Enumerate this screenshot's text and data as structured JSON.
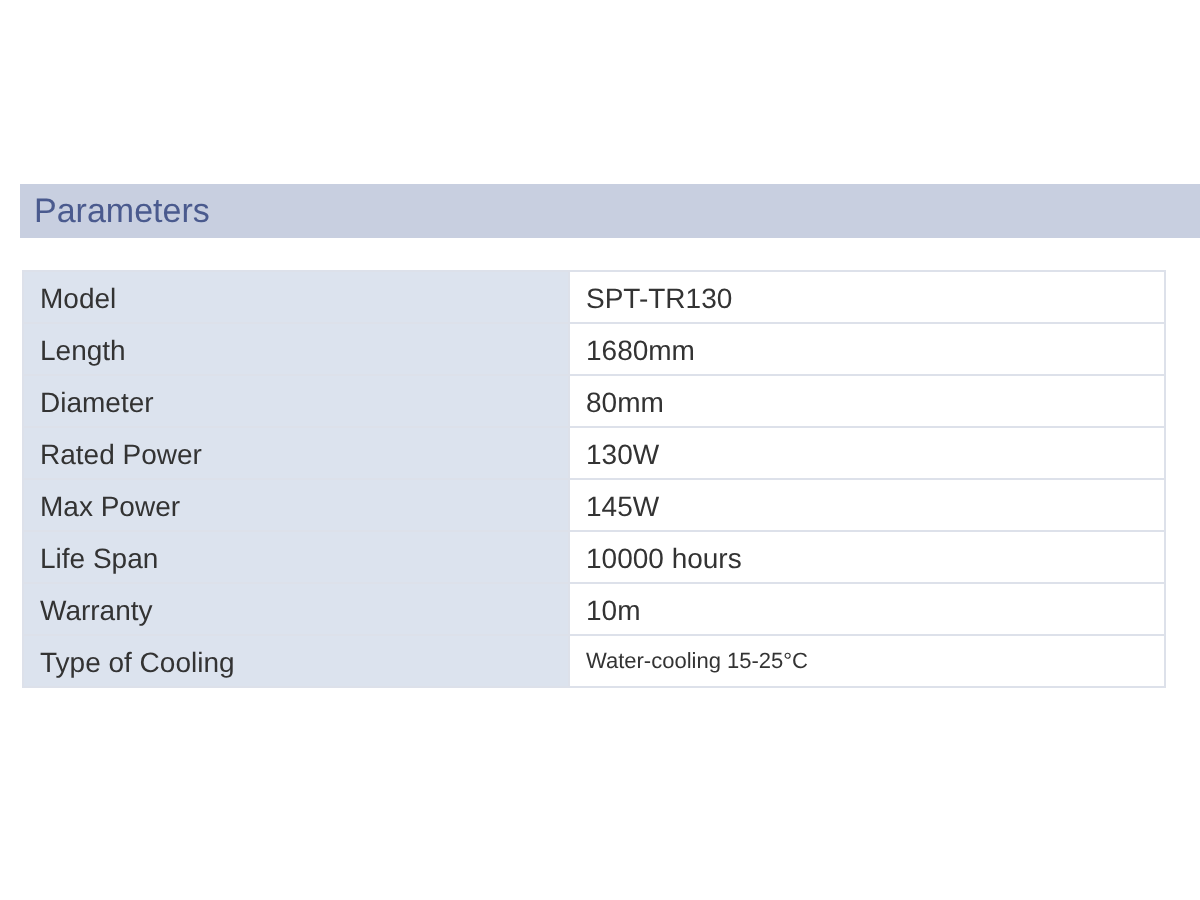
{
  "section": {
    "title": "Parameters"
  },
  "rows": [
    {
      "label": "Model",
      "value": "SPT-TR130",
      "kind": "normal"
    },
    {
      "label": "Length",
      "value": "1680mm",
      "kind": "normal"
    },
    {
      "label": "Diameter",
      "value": "80mm",
      "kind": "normal"
    },
    {
      "label": "Rated Power",
      "value": "130W",
      "kind": "normal"
    },
    {
      "label": "Max Power",
      "value": "145W",
      "kind": "normal"
    },
    {
      "label": "Life Span",
      "value": "10000 hours",
      "kind": "normal"
    },
    {
      "label": "Warranty",
      "value": "10m",
      "kind": "normal"
    },
    {
      "label": "Type of Cooling",
      "value": "Water-cooling 15-25°C",
      "kind": "small"
    }
  ]
}
